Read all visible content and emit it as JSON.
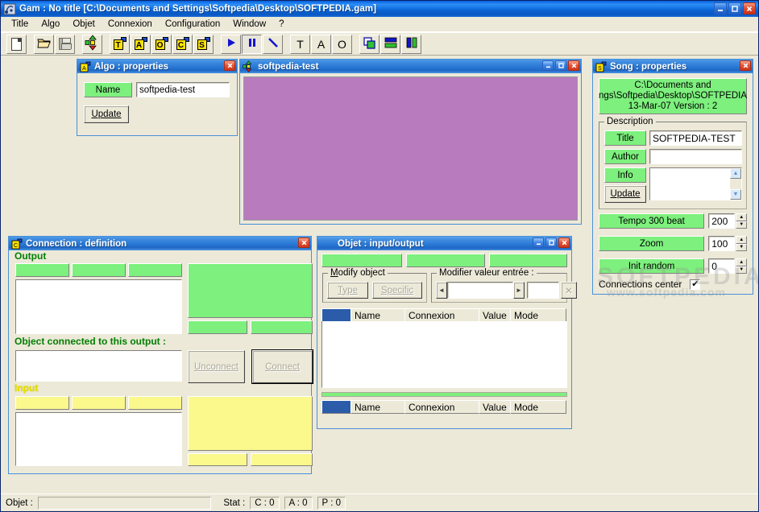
{
  "window": {
    "title": "Gam  :   No title     [C:\\Documents and Settings\\Softpedia\\Desktop\\SOFTPEDIA.gam]",
    "icon": "app-icon",
    "minimize": "–",
    "maximize": "□",
    "close": "✕"
  },
  "menu": {
    "items": [
      {
        "label": "Title"
      },
      {
        "label": "Algo"
      },
      {
        "label": "Objet"
      },
      {
        "label": "Connexion"
      },
      {
        "label": "Configuration"
      },
      {
        "label": "Window"
      },
      {
        "label": "?"
      }
    ]
  },
  "toolbar": {
    "buttons": [
      {
        "name": "new-file-button",
        "icon": "page-icon",
        "label": ""
      },
      {
        "name": "open-file-button",
        "icon": "folder-open-icon",
        "label": ""
      },
      {
        "name": "save-file-button",
        "icon": "floppy-disk-icon",
        "label": ""
      },
      {
        "name": "algo-button",
        "icon": "algo-arrows-icon",
        "label": ""
      },
      {
        "name": "new-title-button",
        "icon": "note-icon",
        "label": "T"
      },
      {
        "name": "new-algo-button",
        "icon": "note-icon",
        "label": "A"
      },
      {
        "name": "new-objet-button",
        "icon": "note-icon",
        "label": "O"
      },
      {
        "name": "new-connexion-button",
        "icon": "note-icon",
        "label": "C"
      },
      {
        "name": "new-song-button",
        "icon": "note-icon",
        "label": "S"
      },
      {
        "name": "play-button",
        "icon": "play-icon",
        "label": "▶"
      },
      {
        "name": "pause-button",
        "icon": "pause-icon",
        "label": "❚❚"
      },
      {
        "name": "stop-line-button",
        "icon": "diagonal-line-icon",
        "label": "╲"
      },
      {
        "name": "text-tool-button",
        "icon": "letter-t-icon",
        "label": "T"
      },
      {
        "name": "letter-a-button",
        "icon": "letter-a-icon",
        "label": "A"
      },
      {
        "name": "letter-o-button",
        "icon": "letter-o-icon",
        "label": "O"
      },
      {
        "name": "duplicate-button",
        "icon": "copy-icon",
        "label": ""
      },
      {
        "name": "tile-horizontal-button",
        "icon": "tile-horizontal-icon",
        "label": ""
      },
      {
        "name": "tile-vertical-button",
        "icon": "tile-vertical-icon",
        "label": ""
      }
    ]
  },
  "algo_window": {
    "title": "Algo : properties",
    "close": "✕",
    "name_label": "Name",
    "name_value": "softpedia-test",
    "update_label": "Update"
  },
  "canvas_window": {
    "title": "softpedia-test",
    "minimize": "–",
    "maximize": "□",
    "close": "✕",
    "canvas_color": "#b87cbe"
  },
  "song_window": {
    "title": "Song : properties",
    "close": "✕",
    "info_lines": [
      "C:\\Documents and",
      "ngs\\Softpedia\\Desktop\\SOFTPEDIA",
      "13-Mar-07   Version : 2"
    ],
    "description_legend": "Description",
    "fields": [
      {
        "label": "Title",
        "value": "SOFTPEDIA-TEST"
      },
      {
        "label": "Author",
        "value": ""
      },
      {
        "label": "Info",
        "value": ""
      }
    ],
    "update_label": "Update",
    "sliders": [
      {
        "label": "Tempo 300 beat",
        "value": "200"
      },
      {
        "label": "Zoom",
        "value": "100"
      },
      {
        "label": "Init random",
        "value": "0"
      }
    ],
    "checkbox": {
      "label": "Connections center",
      "checked": true,
      "mark": "✔"
    }
  },
  "connection_window": {
    "title": "Connection : definition",
    "close": "✕",
    "output_label": "Output",
    "connected_label": "Object connected to this output :",
    "input_label": "Input",
    "unconnect_label": "Unconnect",
    "connect_label": "Connect"
  },
  "objet_window": {
    "title": "Objet : input/output",
    "minimize": "–",
    "maximize": "□",
    "close": "✕",
    "modify_object_legend": "Modify object",
    "type_label": "Type",
    "specific_label": "Specific",
    "modify_value_legend": "Modifier valeur entrée :",
    "spin_value": "",
    "left_arrow": "◄",
    "right_arrow": "►",
    "x_label": "✕",
    "table_headers": [
      "",
      "Name",
      "Connexion",
      "Value",
      "Mode"
    ],
    "table2_headers": [
      "",
      "Name",
      "Connexion",
      "Value",
      "Mode"
    ]
  },
  "statusbar": {
    "objet_label": "Objet :",
    "objet_value": "",
    "stat_label": "Stat :",
    "counters": [
      "C : 0",
      "A : 0",
      "P : 0"
    ]
  },
  "watermark": {
    "line1": "SOFTPEDIA",
    "line2": "www.softpedia.com"
  },
  "colors": {
    "green": "#7df07d",
    "yellow": "#fbf88c",
    "canvas": "#b87cbe",
    "titlebar_blue": "#2877d4",
    "face": "#ece9d8"
  }
}
